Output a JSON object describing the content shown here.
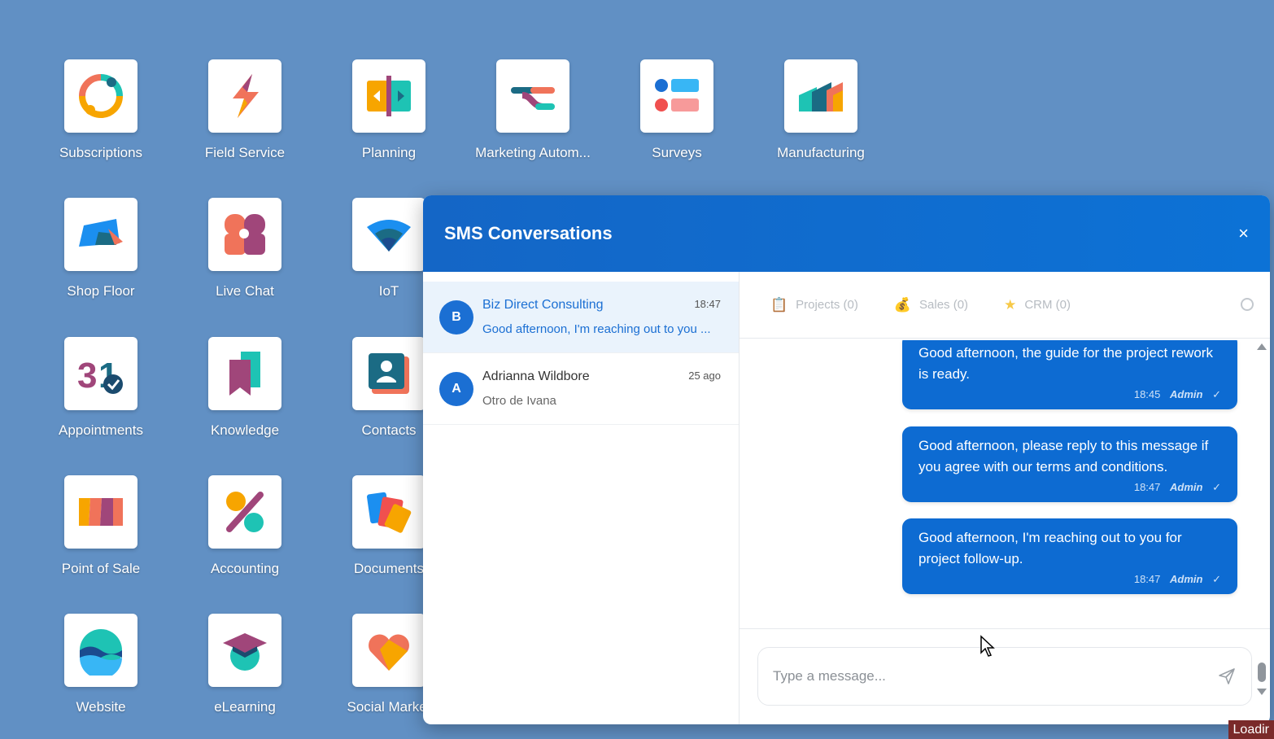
{
  "apps": [
    {
      "label": "Subscriptions",
      "icon": "subscriptions-icon"
    },
    {
      "label": "Field Service",
      "icon": "field-service-icon"
    },
    {
      "label": "Planning",
      "icon": "planning-icon"
    },
    {
      "label": "Marketing Autom...",
      "icon": "marketing-automation-icon"
    },
    {
      "label": "Surveys",
      "icon": "surveys-icon"
    },
    {
      "label": "Manufacturing",
      "icon": "manufacturing-icon"
    },
    {
      "label": "Shop Floor",
      "icon": "shop-floor-icon"
    },
    {
      "label": "Live Chat",
      "icon": "live-chat-icon"
    },
    {
      "label": "IoT",
      "icon": "iot-icon"
    },
    {
      "label": "Appointments",
      "icon": "appointments-icon"
    },
    {
      "label": "Knowledge",
      "icon": "knowledge-icon"
    },
    {
      "label": "Contacts",
      "icon": "contacts-icon"
    },
    {
      "label": "Point of Sale",
      "icon": "point-of-sale-icon"
    },
    {
      "label": "Accounting",
      "icon": "accounting-icon"
    },
    {
      "label": "Documents",
      "icon": "documents-icon"
    },
    {
      "label": "Website",
      "icon": "website-icon"
    },
    {
      "label": "eLearning",
      "icon": "elearning-icon"
    },
    {
      "label": "Social Market",
      "icon": "social-marketing-icon"
    }
  ],
  "sms": {
    "title": "SMS Conversations",
    "close_label": "×",
    "conversations": [
      {
        "avatar": "B",
        "name": "Biz Direct Consulting",
        "preview": "Good afternoon, I'm reaching out to you ...",
        "time": "18:47"
      },
      {
        "avatar": "A",
        "name": "Adrianna Wildbore",
        "preview": "Otro de Ivana",
        "time": "25 ago"
      }
    ],
    "tabs": [
      {
        "label": "Projects (0)",
        "icon": "clipboard-icon"
      },
      {
        "label": "Sales (0)",
        "icon": "money-bag-icon"
      },
      {
        "label": "CRM (0)",
        "icon": "star-icon"
      }
    ],
    "messages": [
      {
        "text": "Good afternoon, the guide for the project rework is ready.",
        "time": "18:45",
        "author": "Admin",
        "status": "✓"
      },
      {
        "text": "Good afternoon, please reply to this message if you agree with our terms and conditions.",
        "time": "18:47",
        "author": "Admin",
        "status": "✓"
      },
      {
        "text": "Good afternoon, I'm reaching out to you for project follow-up.",
        "time": "18:47",
        "author": "Admin",
        "status": "✓"
      }
    ],
    "composer_placeholder": "Type a message..."
  },
  "status_badge": "Loadir"
}
